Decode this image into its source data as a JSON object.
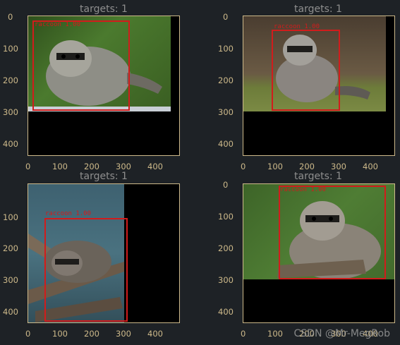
{
  "panels": [
    {
      "title": "targets: 1",
      "label": "raccoon 1.00",
      "xticks": [
        "0",
        "100",
        "200",
        "300",
        "400"
      ],
      "yticks": [
        "0",
        "100",
        "200",
        "300",
        "400"
      ],
      "colors": {
        "bg": "#3a5e22",
        "fg": "#8a8a82"
      }
    },
    {
      "title": "targets: 1",
      "label": "raccoon 1.00",
      "xticks": [
        "0",
        "100",
        "200",
        "300",
        "400"
      ],
      "yticks": [
        "0",
        "100",
        "200",
        "300",
        "400"
      ],
      "colors": {
        "bg": "#5a4b3a",
        "fg": "#6d7c3a"
      }
    },
    {
      "title": "targets: 1",
      "label": "raccoon 1.00",
      "xticks": [
        "0",
        "100",
        "200",
        "300",
        "400"
      ],
      "yticks": [
        "100",
        "200",
        "300",
        "400"
      ],
      "colors": {
        "bg": "#3b5c68",
        "fg": "#6b5a49"
      }
    },
    {
      "title": "targets: 1",
      "label": "raccoon 1.00",
      "xticks": [
        "0",
        "100",
        "200",
        "300",
        "400"
      ],
      "yticks": [
        "0",
        "100",
        "200",
        "300",
        "400"
      ],
      "colors": {
        "bg": "#426a2c",
        "fg": "#8a8378"
      }
    }
  ],
  "watermark": "CSDN @Mr-MegRob"
}
